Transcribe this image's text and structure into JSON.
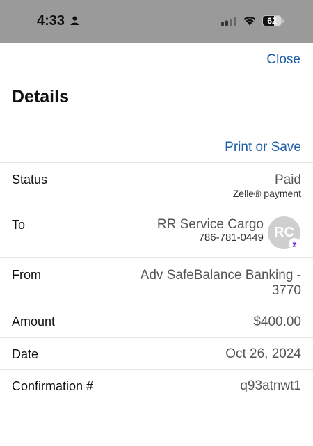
{
  "status_bar": {
    "time": "4:33",
    "battery_level": "62",
    "battery_fraction": 0.62,
    "icons": [
      "person-icon",
      "signal-icon",
      "wifi-icon",
      "battery-icon"
    ]
  },
  "header": {
    "close_label": "Close",
    "title": "Details",
    "print_label": "Print or Save"
  },
  "details": {
    "status": {
      "label": "Status",
      "value": "Paid",
      "sub": "Zelle® payment"
    },
    "to": {
      "label": "To",
      "name": "RR Service Cargo",
      "phone": "786-781-0449",
      "initials": "RC"
    },
    "from": {
      "label": "From",
      "line1": "Adv SafeBalance Banking -",
      "line2": "3770"
    },
    "amount": {
      "label": "Amount",
      "value": "$400.00"
    },
    "date": {
      "label": "Date",
      "value": "Oct 26, 2024"
    },
    "confirmation": {
      "label": "Confirmation #",
      "value": "q93atnwt1"
    }
  },
  "colors": {
    "link": "#1f5fa8",
    "status_bar_bg": "#9a9a9a",
    "zelle_purple": "#6d1ed4"
  }
}
